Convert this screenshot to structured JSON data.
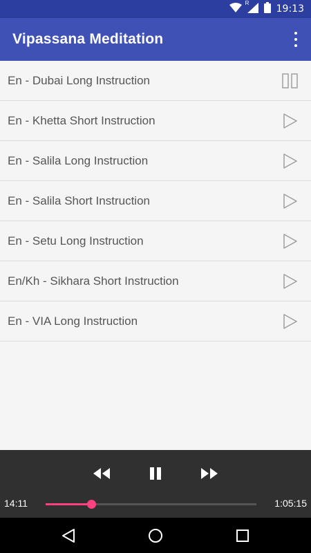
{
  "status_bar": {
    "time": "19:13",
    "icons": [
      "wifi-icon",
      "signal-icon",
      "battery-icon"
    ],
    "roaming_indicator": "R"
  },
  "app_bar": {
    "title": "Vipassana Meditation",
    "menu_icon": "more-vert-icon"
  },
  "tracks": [
    {
      "label": "En - Dubai Long Instruction",
      "icon": "pause-icon"
    },
    {
      "label": "En - Khetta Short Instruction",
      "icon": "play-icon"
    },
    {
      "label": "En - Salila Long Instruction",
      "icon": "play-icon"
    },
    {
      "label": "En - Salila Short Instruction",
      "icon": "play-icon"
    },
    {
      "label": "En - Setu Long Instruction",
      "icon": "play-icon"
    },
    {
      "label": "En/Kh - Sikhara Short Instruction",
      "icon": "play-icon"
    },
    {
      "label": "En - VIA Long Instruction",
      "icon": "play-icon"
    }
  ],
  "player": {
    "current_time": "14:11",
    "total_time": "1:05:15",
    "progress_fraction": 0.217,
    "controls": [
      "rewind-icon",
      "pause-icon",
      "fast-forward-icon"
    ]
  },
  "colors": {
    "status_bar": "#2c3e9f",
    "app_bar": "#3f51b5",
    "accent": "#ff4081",
    "player_bg": "#303030"
  },
  "nav_bar": {
    "buttons": [
      "back-icon",
      "home-icon",
      "recents-icon"
    ]
  }
}
